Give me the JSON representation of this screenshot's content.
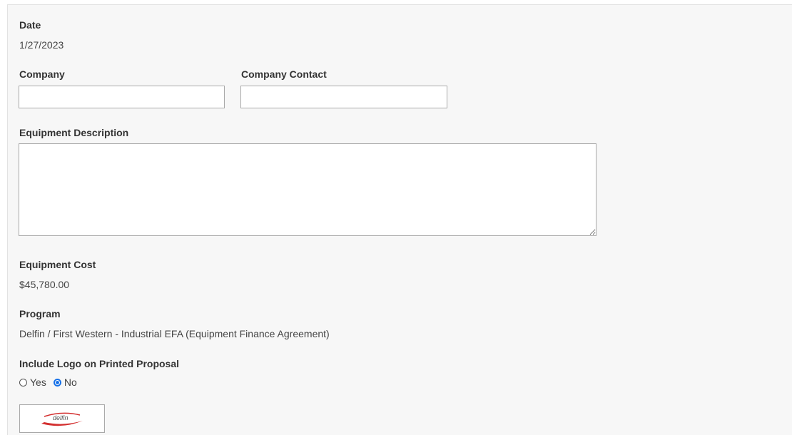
{
  "form": {
    "date": {
      "label": "Date",
      "value": "1/27/2023"
    },
    "company": {
      "label": "Company",
      "value": "",
      "placeholder": ""
    },
    "company_contact": {
      "label": "Company Contact",
      "value": "",
      "placeholder": ""
    },
    "equipment_description": {
      "label": "Equipment Description",
      "value": ""
    },
    "equipment_cost": {
      "label": "Equipment Cost",
      "value": "$45,780.00"
    },
    "program": {
      "label": "Program",
      "value": "Delfin / First Western - Industrial EFA (Equipment Finance Agreement)"
    },
    "include_logo": {
      "label": "Include Logo on Printed Proposal",
      "options": [
        {
          "label": "Yes",
          "checked": false
        },
        {
          "label": "No",
          "checked": true
        }
      ]
    },
    "logo": {
      "text": "delfin",
      "accent_color": "#d32f2f"
    }
  },
  "colors": {
    "radio_accent": "#1a73e8",
    "panel_bg": "#f7f7f7"
  }
}
